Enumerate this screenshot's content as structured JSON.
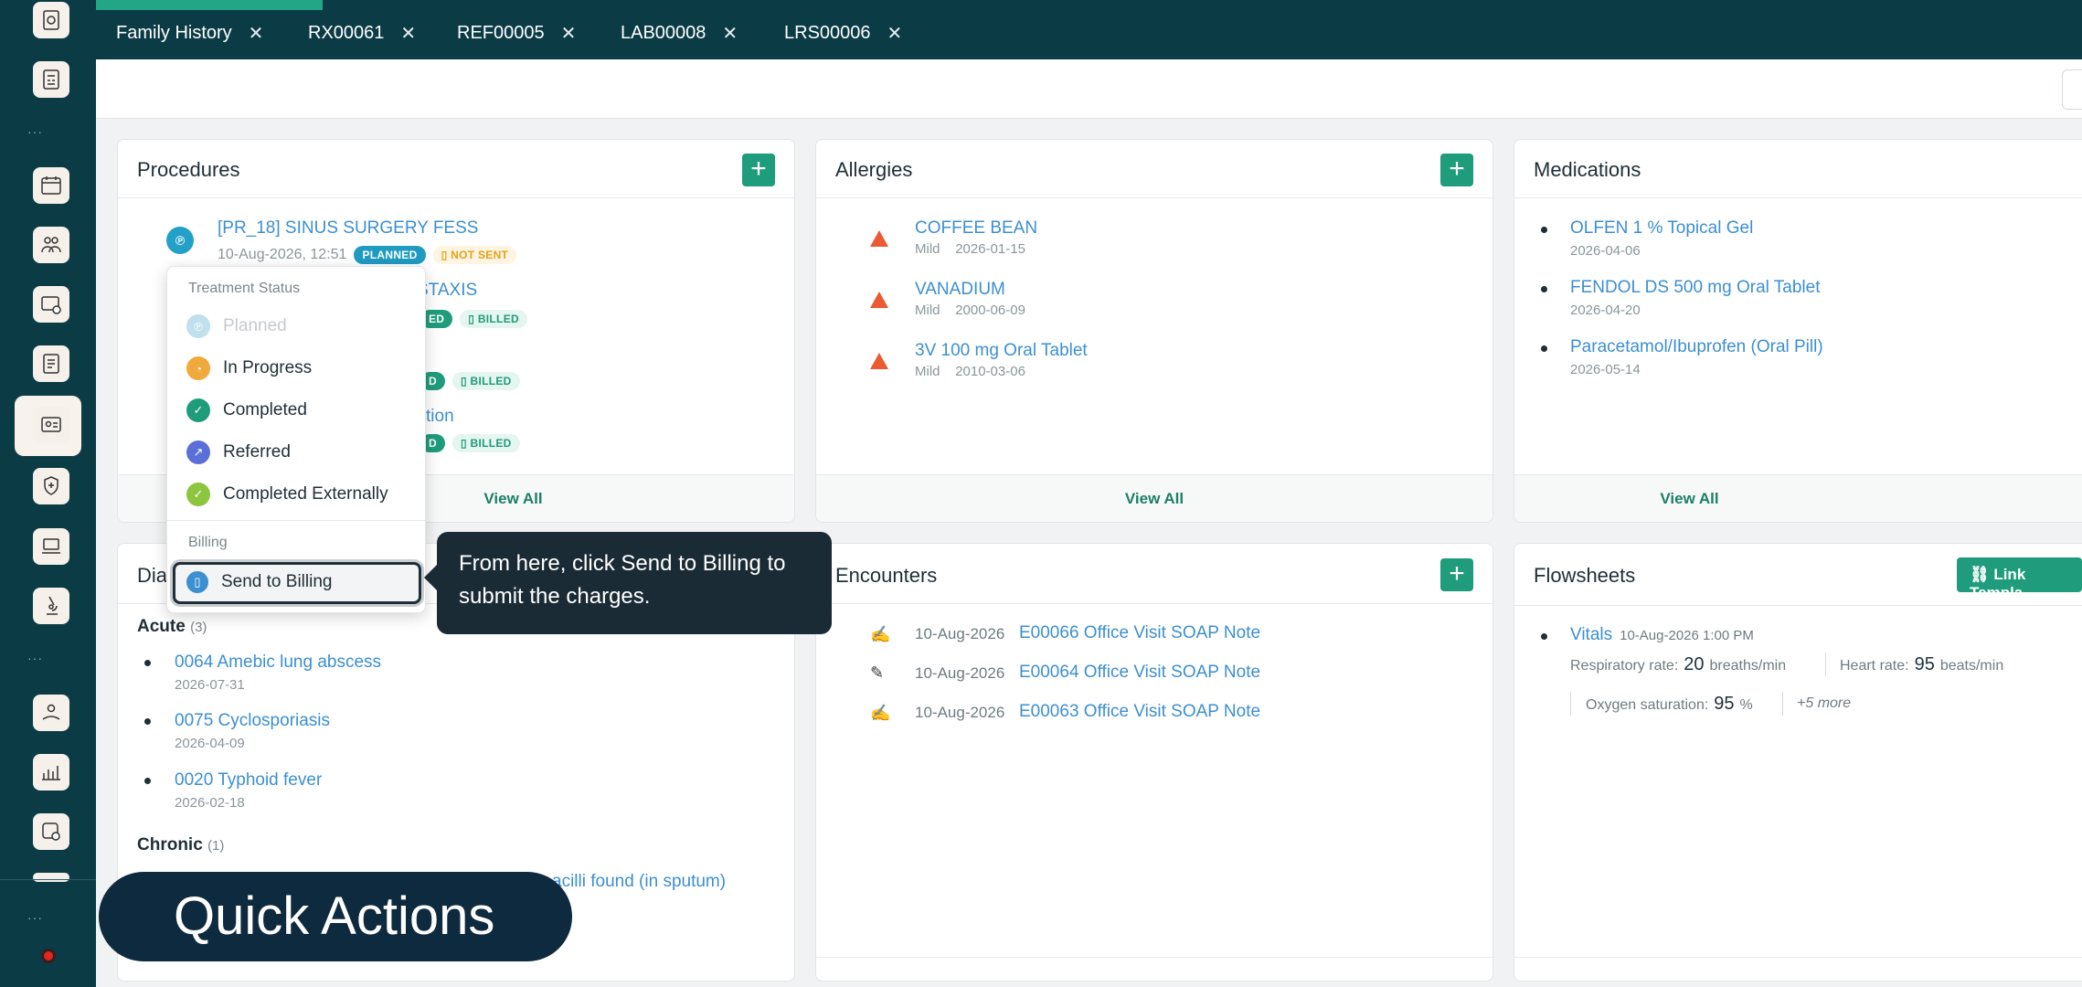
{
  "tabs": [
    {
      "label": "Family History",
      "close": "✕"
    },
    {
      "label": "RX00061",
      "close": "✕"
    },
    {
      "label": "REF00005",
      "close": "✕"
    },
    {
      "label": "LAB00008",
      "close": "✕"
    },
    {
      "label": "LRS00006",
      "close": "✕"
    }
  ],
  "sidebar": {
    "dots": "···"
  },
  "procedures": {
    "title": "Procedures",
    "add": "+",
    "items": [
      {
        "title": "[PR_18] SINUS SURGERY FESS",
        "datetime": "10-Aug-2026, 12:51",
        "status": "PLANNED",
        "billing": "NOT SENT"
      },
      {
        "title_visible": "STAXIS",
        "status_visible": "ED",
        "billing": "BILLED"
      },
      {
        "status_visible": "D",
        "billing": "BILLED"
      },
      {
        "title_visible": "tion",
        "status_visible": "D",
        "billing": "BILLED"
      }
    ],
    "view_all": "View All"
  },
  "status_menu": {
    "section_treatment": "Treatment Status",
    "items": [
      "Planned",
      "In Progress",
      "Completed",
      "Referred",
      "Completed Externally"
    ],
    "section_billing": "Billing",
    "billing_item": "Send to Billing"
  },
  "tooltip": {
    "text": "From here, click Send to Billing to submit the charges."
  },
  "allergies": {
    "title": "Allergies",
    "add": "+",
    "items": [
      {
        "name": "COFFEE BEAN",
        "severity": "Mild",
        "date": "2026-01-15"
      },
      {
        "name": "VANADIUM",
        "severity": "Mild",
        "date": "2000-06-09"
      },
      {
        "name": "3V 100 mg Oral Tablet",
        "severity": "Mild",
        "date": "2010-03-06"
      }
    ],
    "view_all": "View All"
  },
  "medications": {
    "title": "Medications",
    "items": [
      {
        "name": "OLFEN 1 % Topical Gel",
        "date": "2026-04-06"
      },
      {
        "name": "FENDOL DS 500 mg Oral Tablet",
        "date": "2026-04-20"
      },
      {
        "name": "Paracetamol/Ibuprofen (Oral Pill)",
        "date": "2026-05-14"
      }
    ],
    "view_all": "View All"
  },
  "diagnoses": {
    "title_visible": "Dia",
    "acute_label": "Acute",
    "acute_count": "(3)",
    "acute": [
      {
        "name": "0064 Amebic lung abscess",
        "date": "2026-07-31"
      },
      {
        "name": "0075 Cyclosporiasis",
        "date": "2026-04-09"
      },
      {
        "name": "0020 Typhoid fever",
        "date": "2026-02-18"
      }
    ],
    "chronic_label": "Chronic",
    "chronic_count": "(1)",
    "chronic_visible": "acilli found (in sputum)"
  },
  "encounters": {
    "title": "Encounters",
    "add": "+",
    "items": [
      {
        "date": "10-Aug-2026",
        "name": "E00066 Office Visit SOAP Note",
        "icon": "signature-icon"
      },
      {
        "date": "10-Aug-2026",
        "name": "E00064 Office Visit SOAP Note",
        "icon": "pencil-icon"
      },
      {
        "date": "10-Aug-2026",
        "name": "E00063 Office Visit SOAP Note",
        "icon": "signature-icon"
      }
    ]
  },
  "flowsheets": {
    "title": "Flowsheets",
    "link_button": "Link Templa",
    "vitals_label": "Vitals",
    "vitals_date": "10-Aug-2026 1:00 PM",
    "resp_label": "Respiratory rate:",
    "resp_value": "20",
    "resp_unit": "breaths/min",
    "heart_label": "Heart rate:",
    "heart_value": "95",
    "heart_unit": "beats/min",
    "oxy_label": "Oxygen saturation:",
    "oxy_value": "95",
    "oxy_unit": "%",
    "more": "+5 more"
  },
  "quick_actions": {
    "label": "Quick Actions"
  },
  "colors": {
    "sidebar": "#0b3b45",
    "accent": "#1e9c7b",
    "link": "#3c8fd0",
    "warning": "#ea5a33"
  }
}
